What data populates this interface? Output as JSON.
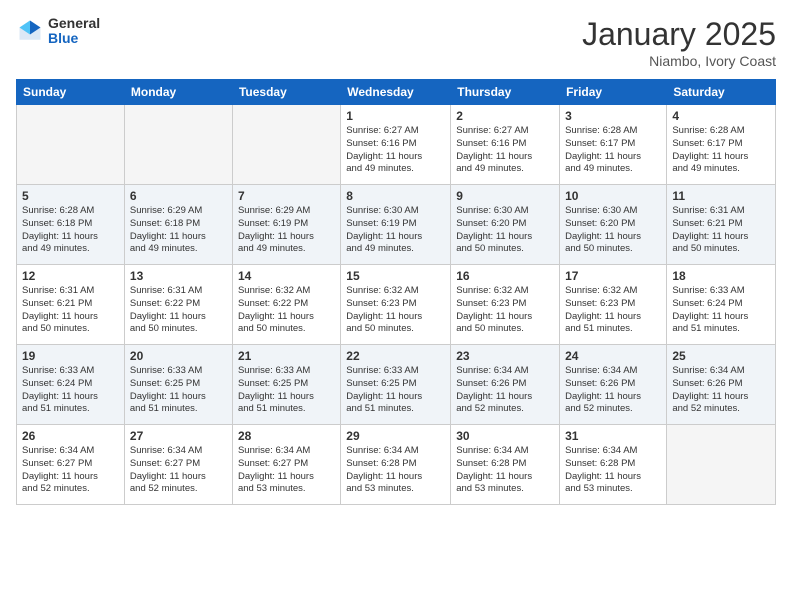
{
  "logo": {
    "general": "General",
    "blue": "Blue"
  },
  "title": "January 2025",
  "location": "Niambo, Ivory Coast",
  "weekdays": [
    "Sunday",
    "Monday",
    "Tuesday",
    "Wednesday",
    "Thursday",
    "Friday",
    "Saturday"
  ],
  "weeks": [
    [
      {
        "day": "",
        "info": ""
      },
      {
        "day": "",
        "info": ""
      },
      {
        "day": "",
        "info": ""
      },
      {
        "day": "1",
        "info": "Sunrise: 6:27 AM\nSunset: 6:16 PM\nDaylight: 11 hours\nand 49 minutes."
      },
      {
        "day": "2",
        "info": "Sunrise: 6:27 AM\nSunset: 6:16 PM\nDaylight: 11 hours\nand 49 minutes."
      },
      {
        "day": "3",
        "info": "Sunrise: 6:28 AM\nSunset: 6:17 PM\nDaylight: 11 hours\nand 49 minutes."
      },
      {
        "day": "4",
        "info": "Sunrise: 6:28 AM\nSunset: 6:17 PM\nDaylight: 11 hours\nand 49 minutes."
      }
    ],
    [
      {
        "day": "5",
        "info": "Sunrise: 6:28 AM\nSunset: 6:18 PM\nDaylight: 11 hours\nand 49 minutes."
      },
      {
        "day": "6",
        "info": "Sunrise: 6:29 AM\nSunset: 6:18 PM\nDaylight: 11 hours\nand 49 minutes."
      },
      {
        "day": "7",
        "info": "Sunrise: 6:29 AM\nSunset: 6:19 PM\nDaylight: 11 hours\nand 49 minutes."
      },
      {
        "day": "8",
        "info": "Sunrise: 6:30 AM\nSunset: 6:19 PM\nDaylight: 11 hours\nand 49 minutes."
      },
      {
        "day": "9",
        "info": "Sunrise: 6:30 AM\nSunset: 6:20 PM\nDaylight: 11 hours\nand 50 minutes."
      },
      {
        "day": "10",
        "info": "Sunrise: 6:30 AM\nSunset: 6:20 PM\nDaylight: 11 hours\nand 50 minutes."
      },
      {
        "day": "11",
        "info": "Sunrise: 6:31 AM\nSunset: 6:21 PM\nDaylight: 11 hours\nand 50 minutes."
      }
    ],
    [
      {
        "day": "12",
        "info": "Sunrise: 6:31 AM\nSunset: 6:21 PM\nDaylight: 11 hours\nand 50 minutes."
      },
      {
        "day": "13",
        "info": "Sunrise: 6:31 AM\nSunset: 6:22 PM\nDaylight: 11 hours\nand 50 minutes."
      },
      {
        "day": "14",
        "info": "Sunrise: 6:32 AM\nSunset: 6:22 PM\nDaylight: 11 hours\nand 50 minutes."
      },
      {
        "day": "15",
        "info": "Sunrise: 6:32 AM\nSunset: 6:23 PM\nDaylight: 11 hours\nand 50 minutes."
      },
      {
        "day": "16",
        "info": "Sunrise: 6:32 AM\nSunset: 6:23 PM\nDaylight: 11 hours\nand 50 minutes."
      },
      {
        "day": "17",
        "info": "Sunrise: 6:32 AM\nSunset: 6:23 PM\nDaylight: 11 hours\nand 51 minutes."
      },
      {
        "day": "18",
        "info": "Sunrise: 6:33 AM\nSunset: 6:24 PM\nDaylight: 11 hours\nand 51 minutes."
      }
    ],
    [
      {
        "day": "19",
        "info": "Sunrise: 6:33 AM\nSunset: 6:24 PM\nDaylight: 11 hours\nand 51 minutes."
      },
      {
        "day": "20",
        "info": "Sunrise: 6:33 AM\nSunset: 6:25 PM\nDaylight: 11 hours\nand 51 minutes."
      },
      {
        "day": "21",
        "info": "Sunrise: 6:33 AM\nSunset: 6:25 PM\nDaylight: 11 hours\nand 51 minutes."
      },
      {
        "day": "22",
        "info": "Sunrise: 6:33 AM\nSunset: 6:25 PM\nDaylight: 11 hours\nand 51 minutes."
      },
      {
        "day": "23",
        "info": "Sunrise: 6:34 AM\nSunset: 6:26 PM\nDaylight: 11 hours\nand 52 minutes."
      },
      {
        "day": "24",
        "info": "Sunrise: 6:34 AM\nSunset: 6:26 PM\nDaylight: 11 hours\nand 52 minutes."
      },
      {
        "day": "25",
        "info": "Sunrise: 6:34 AM\nSunset: 6:26 PM\nDaylight: 11 hours\nand 52 minutes."
      }
    ],
    [
      {
        "day": "26",
        "info": "Sunrise: 6:34 AM\nSunset: 6:27 PM\nDaylight: 11 hours\nand 52 minutes."
      },
      {
        "day": "27",
        "info": "Sunrise: 6:34 AM\nSunset: 6:27 PM\nDaylight: 11 hours\nand 52 minutes."
      },
      {
        "day": "28",
        "info": "Sunrise: 6:34 AM\nSunset: 6:27 PM\nDaylight: 11 hours\nand 53 minutes."
      },
      {
        "day": "29",
        "info": "Sunrise: 6:34 AM\nSunset: 6:28 PM\nDaylight: 11 hours\nand 53 minutes."
      },
      {
        "day": "30",
        "info": "Sunrise: 6:34 AM\nSunset: 6:28 PM\nDaylight: 11 hours\nand 53 minutes."
      },
      {
        "day": "31",
        "info": "Sunrise: 6:34 AM\nSunset: 6:28 PM\nDaylight: 11 hours\nand 53 minutes."
      },
      {
        "day": "",
        "info": ""
      }
    ]
  ]
}
